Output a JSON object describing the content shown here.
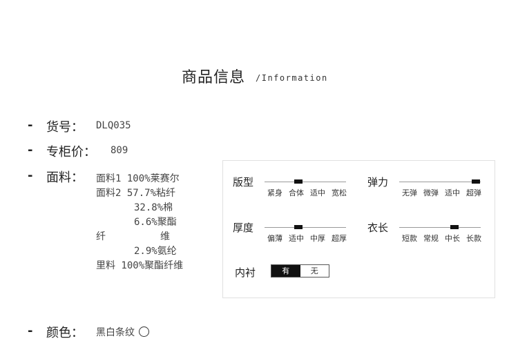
{
  "header": {
    "title": "商品信息",
    "subtitle": "/Information"
  },
  "info": {
    "bullet": "-",
    "item_no_label": "货号：",
    "item_no": "DLQ035",
    "price_label": "专柜价：",
    "price": "809",
    "fabric_label": "面料：",
    "fabric_lines": [
      "面料1 100%莱赛尔",
      "面料2 57.7%粘纤",
      "32.8%棉",
      "6.6%聚酯",
      "纤",
      "维",
      "2.9%氨纶",
      "里料 100%聚酯纤维"
    ],
    "color_label": "颜色：",
    "color": "黑白条纹"
  },
  "attributes": {
    "fit": {
      "label": "版型",
      "options": [
        "紧身",
        "合体",
        "适中",
        "宽松"
      ],
      "selected_index": 1
    },
    "elasticity": {
      "label": "弹力",
      "options": [
        "无弹",
        "微弹",
        "适中",
        "超弹"
      ],
      "selected_index": 3
    },
    "thickness": {
      "label": "厚度",
      "options": [
        "偏薄",
        "适中",
        "中厚",
        "超厚"
      ],
      "selected_index": 1
    },
    "length": {
      "label": "衣长",
      "options": [
        "短款",
        "常规",
        "中长",
        "长款"
      ],
      "selected_index": 2
    },
    "lining": {
      "label": "内衬",
      "options": [
        "有",
        "无"
      ],
      "selected_index": 0
    }
  },
  "colors": {
    "selected_marker": "#111111",
    "scale_line": "#999999"
  }
}
